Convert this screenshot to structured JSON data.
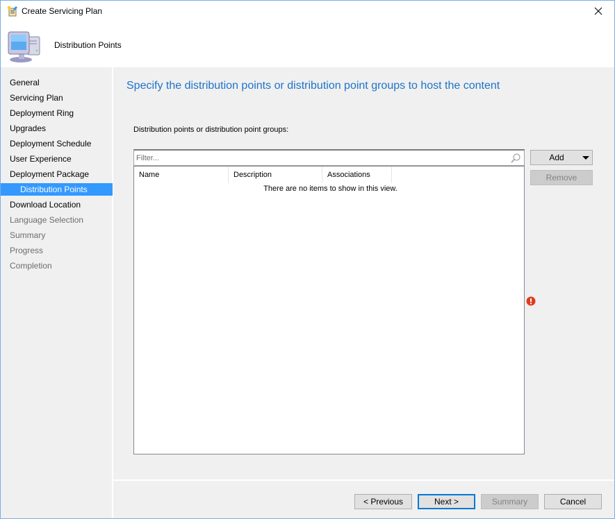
{
  "window": {
    "title": "Create Servicing Plan",
    "close_icon": "close-icon"
  },
  "header": {
    "title": "Distribution Points",
    "icon": "computer-icon"
  },
  "sidebar": {
    "items": [
      {
        "label": "General",
        "state": "normal"
      },
      {
        "label": "Servicing Plan",
        "state": "normal"
      },
      {
        "label": "Deployment Ring",
        "state": "normal"
      },
      {
        "label": "Upgrades",
        "state": "normal"
      },
      {
        "label": "Deployment Schedule",
        "state": "normal"
      },
      {
        "label": "User Experience",
        "state": "normal"
      },
      {
        "label": "Deployment Package",
        "state": "normal"
      },
      {
        "label": "Distribution Points",
        "state": "active"
      },
      {
        "label": "Download Location",
        "state": "normal"
      },
      {
        "label": "Language Selection",
        "state": "disabled"
      },
      {
        "label": "Summary",
        "state": "disabled"
      },
      {
        "label": "Progress",
        "state": "disabled"
      },
      {
        "label": "Completion",
        "state": "disabled"
      }
    ]
  },
  "main": {
    "heading": "Specify the distribution points or distribution point groups to host the content",
    "list_label": "Distribution points or distribution point groups:",
    "filter": {
      "placeholder": "Filter...",
      "value": "",
      "icon": "search-icon"
    },
    "columns": [
      "Name",
      "Description",
      "Associations"
    ],
    "rows": [],
    "empty_message": "There are no items to show in this view.",
    "add_button": "Add",
    "remove_button": "Remove",
    "validation_icon": "error-icon"
  },
  "footer": {
    "previous": "< Previous",
    "next": "Next >",
    "summary": "Summary",
    "cancel": "Cancel"
  },
  "colors": {
    "accent": "#3399ff",
    "heading": "#1e73c8",
    "default_button_border": "#0078d7",
    "error": "#e03c1f"
  }
}
